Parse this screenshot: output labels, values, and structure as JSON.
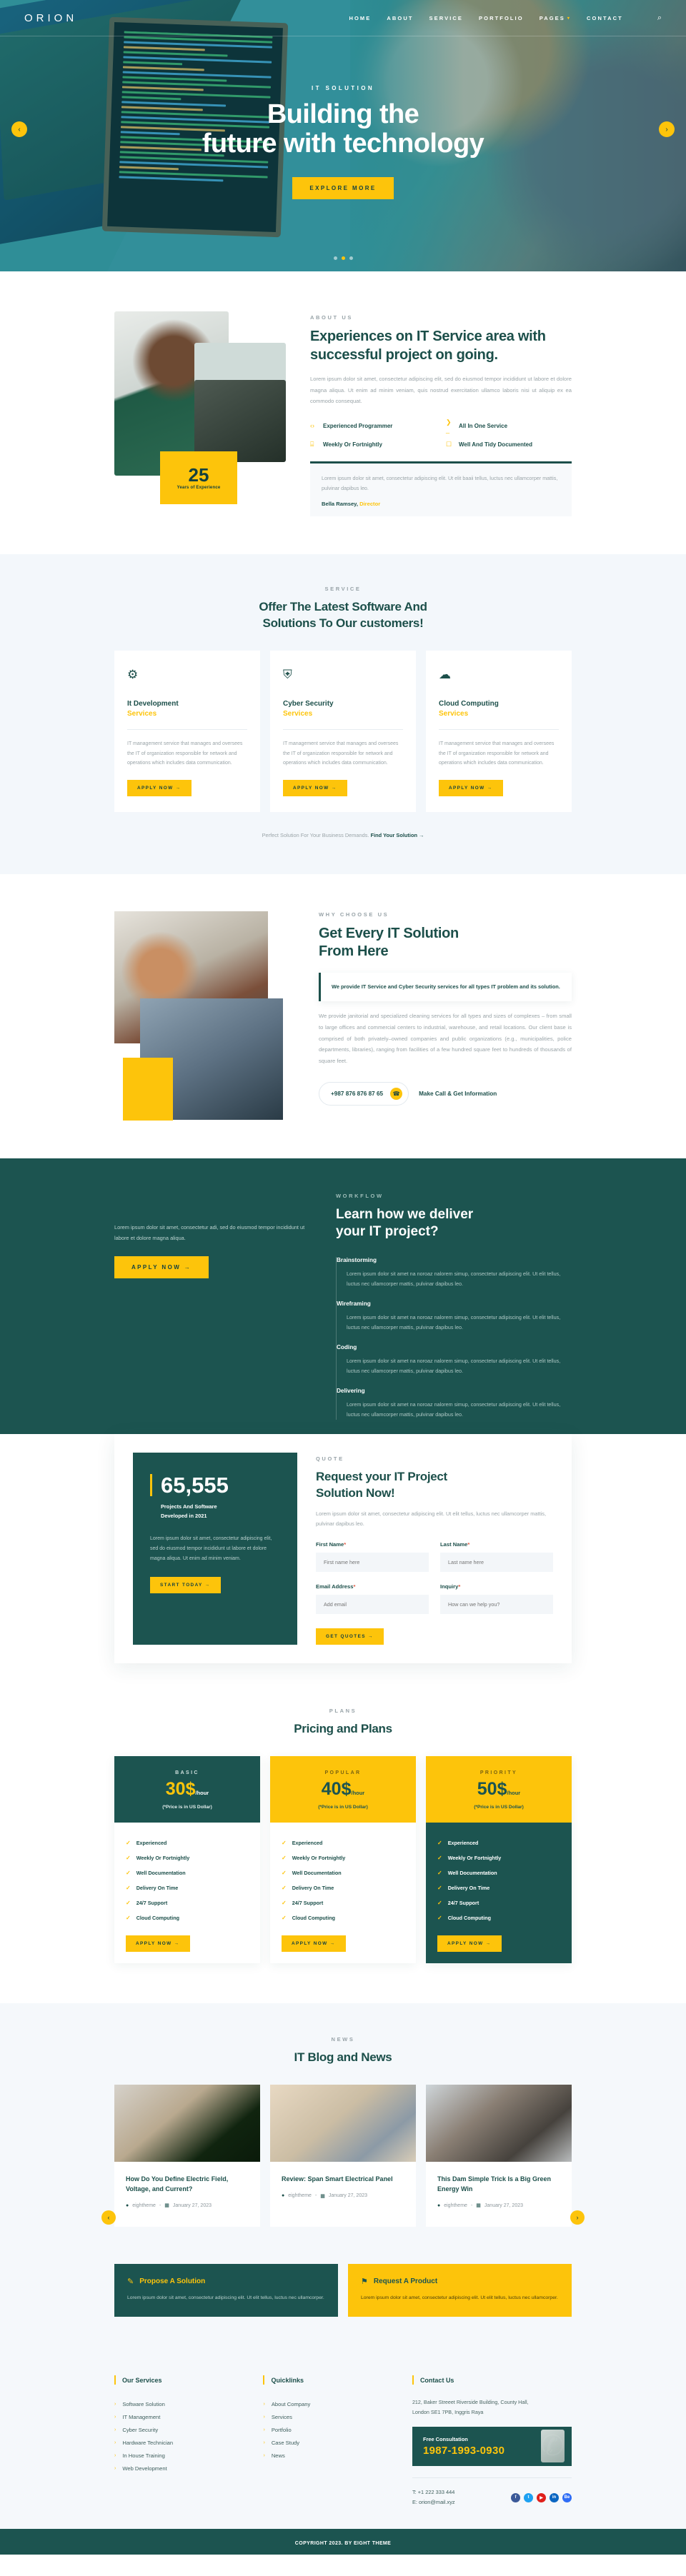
{
  "header": {
    "logo": "ORION",
    "nav": [
      {
        "label": "HOME"
      },
      {
        "label": "ABOUT"
      },
      {
        "label": "SERVICE"
      },
      {
        "label": "PORTFOLIO"
      },
      {
        "label": "PAGES"
      },
      {
        "label": "CONTACT"
      }
    ],
    "pages_caret": "▾",
    "search_icon": "⌕"
  },
  "hero": {
    "eyebrow": "IT SOLUTION",
    "title_line1": "Building the",
    "title_line2": "future with technology",
    "cta": "EXPLORE MORE",
    "cta_arrow": "→",
    "prev": "‹",
    "next": "›"
  },
  "about": {
    "eyebrow": "ABOUT US",
    "title": "Experiences on IT Service area with successful project on going.",
    "paragraph": "Lorem ipsum dolor sit amet, consectetur adipiscing elit, sed do eiusmod tempor incididunt ut labore et dolore magna aliqua. Ut enim ad minim veniam, quis nostrud exercitation ullamco laboris nisi ut aliquip ex ea commodo consequat.",
    "badge_number": "25",
    "badge_label": "Years of Experience",
    "features": [
      {
        "icon": "‹›",
        "label": "Experienced Programmer"
      },
      {
        "icon": "❯_",
        "label": "All In One Service"
      },
      {
        "icon": "⌸",
        "label": "Weekly Or Fortnightly"
      },
      {
        "icon": "☐",
        "label": "Well And Tidy Documented"
      }
    ],
    "quote_text": "Lorem ipsum dolor sit amet, consectetur adipiscing elit. Ut elit baaii tellus, luctus nec ullamcorper mattis, pulvinar dapibus leo.",
    "quote_author": "Bella Ramsey,",
    "quote_role": "Director"
  },
  "services": {
    "eyebrow": "SERVICE",
    "title_line1": "Offer The Latest Software And",
    "title_line2": "Solutions To Our customers!",
    "cards": [
      {
        "icon": "⚙",
        "title": "It Development",
        "subtitle": "Services",
        "text": "IT management service that manages and oversees the IT of organization responsible for network and operations which includes data communication.",
        "button": "APPLY NOW →"
      },
      {
        "icon": "⛨",
        "title": "Cyber Security",
        "subtitle": "Services",
        "text": "IT management service that manages and oversees the IT of organization responsible for network and operations which includes data communication.",
        "button": "APPLY NOW →"
      },
      {
        "icon": "☁",
        "title": "Cloud Computing",
        "subtitle": "Services",
        "text": "IT management service that manages and oversees the IT of organization responsible for network and operations which includes data communication.",
        "button": "APPLY NOW →"
      }
    ],
    "footer_text": "Perfect Solution For Your Business Demands. ",
    "footer_link": "Find Your Solution →"
  },
  "why": {
    "eyebrow": "WHY CHOOSE US",
    "title_line1": "Get Every IT Solution",
    "title_line2": "From Here",
    "callout": "We provide IT Service and Cyber Security services for all types IT problem and its solution.",
    "paragraph": "We provide janitorial and specialized cleaning services for all types and sizes of complexes – from small to large offices and commercial centers to industrial, warehouse, and retail locations. Our client base is comprised of both privately–owned companies and public organizations (e.g., municipalities, police departments, libraries), ranging from facilities of a few hundred square feet to hundreds of thousands of square feet.",
    "phone": "+987 876 876 87 65",
    "phone_icon": "☎",
    "make_call": "Make Call & Get Information"
  },
  "workflow": {
    "left_text": "Lorem ipsum dolor sit amet, consectetur adi, sed do eiusmod tempor incididunt ut labore et dolore magna aliqua.",
    "apply_button": "APPLY NOW →",
    "eyebrow": "WORKFLOW",
    "title_line1": "Learn how we deliver",
    "title_line2": "your IT project?",
    "steps": [
      {
        "title": "Brainstorming",
        "text": "Lorem ipsum dolor sit amet na noroaz nalorem simup, consectetur adipiscing elit. Ut elit tellus, luctus nec ullamcorper mattis, pulvinar dapibus leo."
      },
      {
        "title": "Wireframing",
        "text": "Lorem ipsum dolor sit amet na noroaz nalorem simup, consectetur adipiscing elit. Ut elit tellus, luctus nec ullamcorper mattis, pulvinar dapibus leo."
      },
      {
        "title": "Coding",
        "text": "Lorem ipsum dolor sit amet na noroaz nalorem simup, consectetur adipiscing elit. Ut elit tellus, luctus nec ullamcorper mattis, pulvinar dapibus leo."
      },
      {
        "title": "Delivering",
        "text": "Lorem ipsum dolor sit amet na noroaz nalorem simup, consectetur adipiscing elit. Ut elit tellus, luctus nec ullamcorper mattis, pulvinar dapibus leo."
      }
    ]
  },
  "quote": {
    "counter_number": "65,555",
    "counter_label_1": "Projects And Software",
    "counter_label_2": "Developed in 2021",
    "counter_text": "Lorem ipsum dolor sit amet, consectetur adipiscing elit, sed do eiusmod tempor incididunt ut labore et dolore magna aliqua. Ut enim ad minim veniam.",
    "counter_button": "START TODAY →",
    "eyebrow": "QUOTE",
    "title_line1": "Request your IT Project",
    "title_line2": "Solution Now!",
    "subtitle": "Lorem ipsum dolor sit amet, consectetur adipiscing elit. Ut elit tellus, luctus nec ullamcorper mattis, pulvinar dapibus leo.",
    "fields": [
      {
        "label": "First Name",
        "required": "*",
        "placeholder": "First name here",
        "value": ""
      },
      {
        "label": "Last Name",
        "required": "*",
        "placeholder": "Last name here",
        "value": ""
      },
      {
        "label": "Email Address",
        "required": "*",
        "placeholder": "Add email",
        "value": ""
      },
      {
        "label": "Inquiry",
        "required": "*",
        "placeholder": "How can we help you?",
        "value": ""
      }
    ],
    "submit": "GET QUOTES →"
  },
  "pricing": {
    "eyebrow": "PLANS",
    "title": "Pricing and Plans",
    "plans": [
      {
        "tier": "BASIC",
        "price": "30$",
        "per": "/hour",
        "note": "(*Price is in US Dollar)",
        "features": [
          "Experienced",
          "Weekly Or Fortnightly",
          "Well Documentation",
          "Delivery On Time",
          "24/7 Support",
          "Cloud Computing"
        ],
        "button": "APPLY NOW →"
      },
      {
        "tier": "POPULAR",
        "price": "40$",
        "per": "/hour",
        "note": "(*Price is in US Dollar)",
        "features": [
          "Experienced",
          "Weekly Or Fortnightly",
          "Well Documentation",
          "Delivery On Time",
          "24/7 Support",
          "Cloud Computing"
        ],
        "button": "APPLY NOW →"
      },
      {
        "tier": "PRIORITY",
        "price": "50$",
        "per": "/hour",
        "note": "(*Price is in US Dollar)",
        "features": [
          "Experienced",
          "Weekly Or Fortnightly",
          "Well Documentation",
          "Delivery On Time",
          "24/7 Support",
          "Cloud Computing"
        ],
        "button": "APPLY NOW →"
      }
    ]
  },
  "blog": {
    "eyebrow": "NEWS",
    "title": "IT Blog and News",
    "prev": "‹",
    "next": "›",
    "posts": [
      {
        "title": "How Do You Define Electric Field, Voltage, and Current?",
        "author": "eightheme",
        "date": "January 27, 2023"
      },
      {
        "title": "Review: Span Smart Electrical Panel",
        "author": "eightheme",
        "date": "January 27, 2023"
      },
      {
        "title": "This Dam Simple Trick Is a Big Green Energy Win",
        "author": "eightheme",
        "date": "January 27, 2023"
      }
    ],
    "author_icon": "●",
    "date_icon": "▦"
  },
  "cta": {
    "left": {
      "icon": "✎",
      "title": "Propose A Solution",
      "text": "Lorem ipsum dolor sit amet, consectetur adipiscing elit. Ut elit tellus, luctus nec ullamcorper."
    },
    "right": {
      "icon": "⚑",
      "title": "Request A Product",
      "text": "Lorem ipsum dolor sit amet, consectetur adipiscing elit. Ut elit tellus, luctus nec ullamcorper."
    }
  },
  "footer": {
    "col1": {
      "title": "Our Services",
      "links": [
        "Software Solution",
        "IT Management",
        "Cyber Security",
        "Hardware Technician",
        "In House Training",
        "Web Development"
      ]
    },
    "col2": {
      "title": "Quicklinks",
      "links": [
        "About Company",
        "Services",
        "Portfolio",
        "Case Study",
        "News"
      ]
    },
    "contact": {
      "title": "Contact Us",
      "address_line1": "212, Baker Streeet Riverside Building, County Hall,",
      "address_line2": "London SE1 7PB, Inggris Raya",
      "consult_label": "Free Consultation",
      "consult_number": "1987-1993-0930",
      "phone": "T: +1 222 333 444",
      "email": "E: orion@mail.xyz",
      "socials": [
        {
          "name": "facebook-icon",
          "glyph": "f",
          "color": "#3b5998"
        },
        {
          "name": "twitter-icon",
          "glyph": "t",
          "color": "#1da1f2"
        },
        {
          "name": "youtube-icon",
          "glyph": "▶",
          "color": "#e0201b"
        },
        {
          "name": "linkedin-icon",
          "glyph": "in",
          "color": "#0a66c2"
        },
        {
          "name": "behance-icon",
          "glyph": "Be",
          "color": "#2f6df6"
        }
      ]
    },
    "copyright": "COPYRIGHT 2023. BY EIGHT THEME"
  },
  "colors": {
    "teal": "#1c5450",
    "dark_teal": "#1c4f4a",
    "gold": "#fdc40b",
    "hero_blue": "#3aa8b0",
    "light_bg": "#f5f8fb"
  },
  "link_arrow": "›",
  "check_icon": "✓"
}
